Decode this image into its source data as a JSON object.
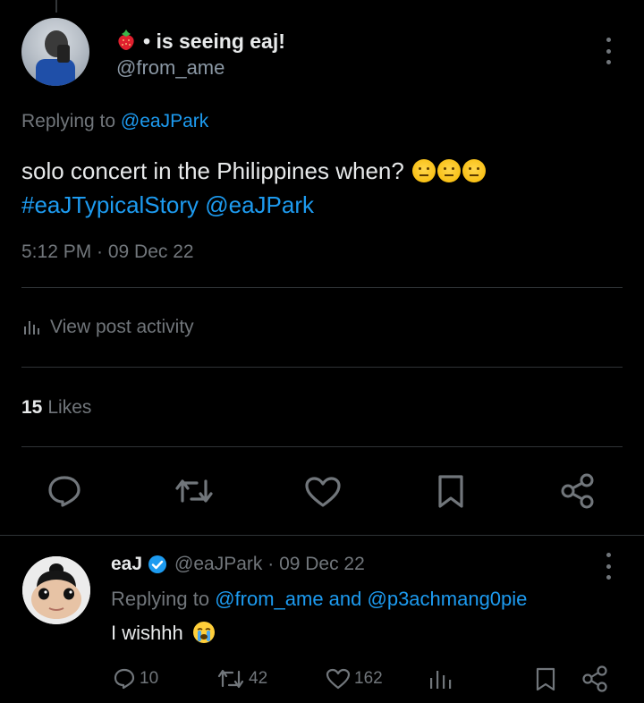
{
  "main_post": {
    "display_name": "• is seeing eaj!",
    "handle": "@from_ame",
    "replying_prefix": "Replying to ",
    "replying_to": "@eaJPark",
    "text": "solo concert in the Philippines when?",
    "hashtag": "#eaJTypicalStory",
    "mention": "@eaJPark",
    "timestamp": "5:12 PM · 09 Dec 22",
    "view_activity": "View post activity",
    "likes_count": "15",
    "likes_label": "Likes"
  },
  "reply": {
    "display_name": "eaJ",
    "handle_time": "@eaJPark · 09 Dec 22",
    "replying_prefix": "Replying to ",
    "replying_to_1": "@from_ame",
    "replying_and": " and ",
    "replying_to_2": "@p3achmang0pie",
    "text": "I wishhh",
    "replies": "10",
    "reposts": "42",
    "likes": "162"
  },
  "colors": {
    "background": "#000000",
    "text": "#e7e9ea",
    "muted": "#71767b",
    "link": "#1d9bf0",
    "divider": "#2f3336"
  },
  "icons": [
    "strawberry-icon",
    "more-icon",
    "chart-icon",
    "reply-icon",
    "repost-icon",
    "like-icon",
    "bookmark-icon",
    "share-icon",
    "verified-icon",
    "emoji-icon"
  ]
}
